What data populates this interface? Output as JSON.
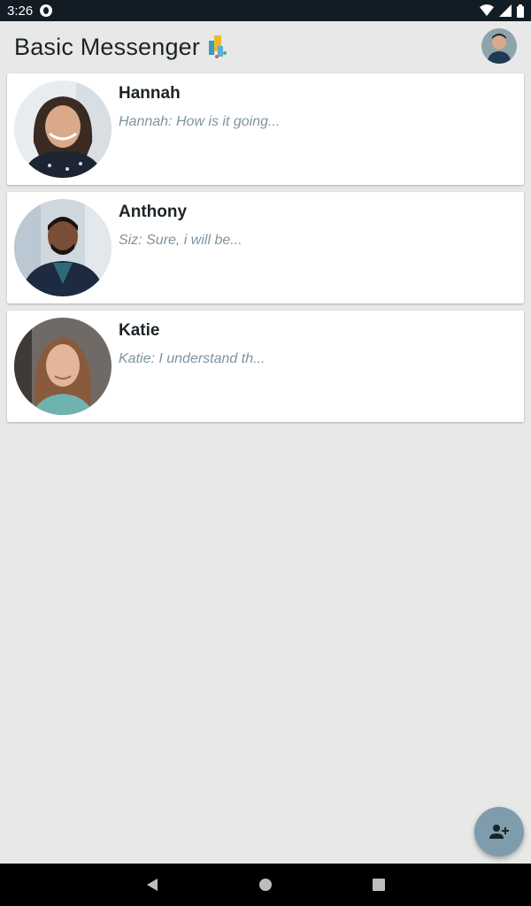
{
  "status_bar": {
    "time": "3:26"
  },
  "app_bar": {
    "title": "Basic Messenger"
  },
  "conversations": [
    {
      "name": "Hannah",
      "preview": "Hannah: How is it going...",
      "avatar_color": "#6b4a3a"
    },
    {
      "name": "Anthony",
      "preview": "Siz: Sure, i will be...",
      "avatar_color": "#2f3b4a"
    },
    {
      "name": "Katie",
      "preview": "Katie: I understand th...",
      "avatar_color": "#8a6a52"
    }
  ],
  "icons": {
    "fab": "add-person-icon",
    "nav_back": "back-triangle-icon",
    "nav_home": "home-circle-icon",
    "nav_recent": "recent-square-icon"
  },
  "colors": {
    "status_bar": "#121c24",
    "background": "#e8e8e8",
    "preview_text": "#7e93a0",
    "fab": "#7e9cac"
  }
}
